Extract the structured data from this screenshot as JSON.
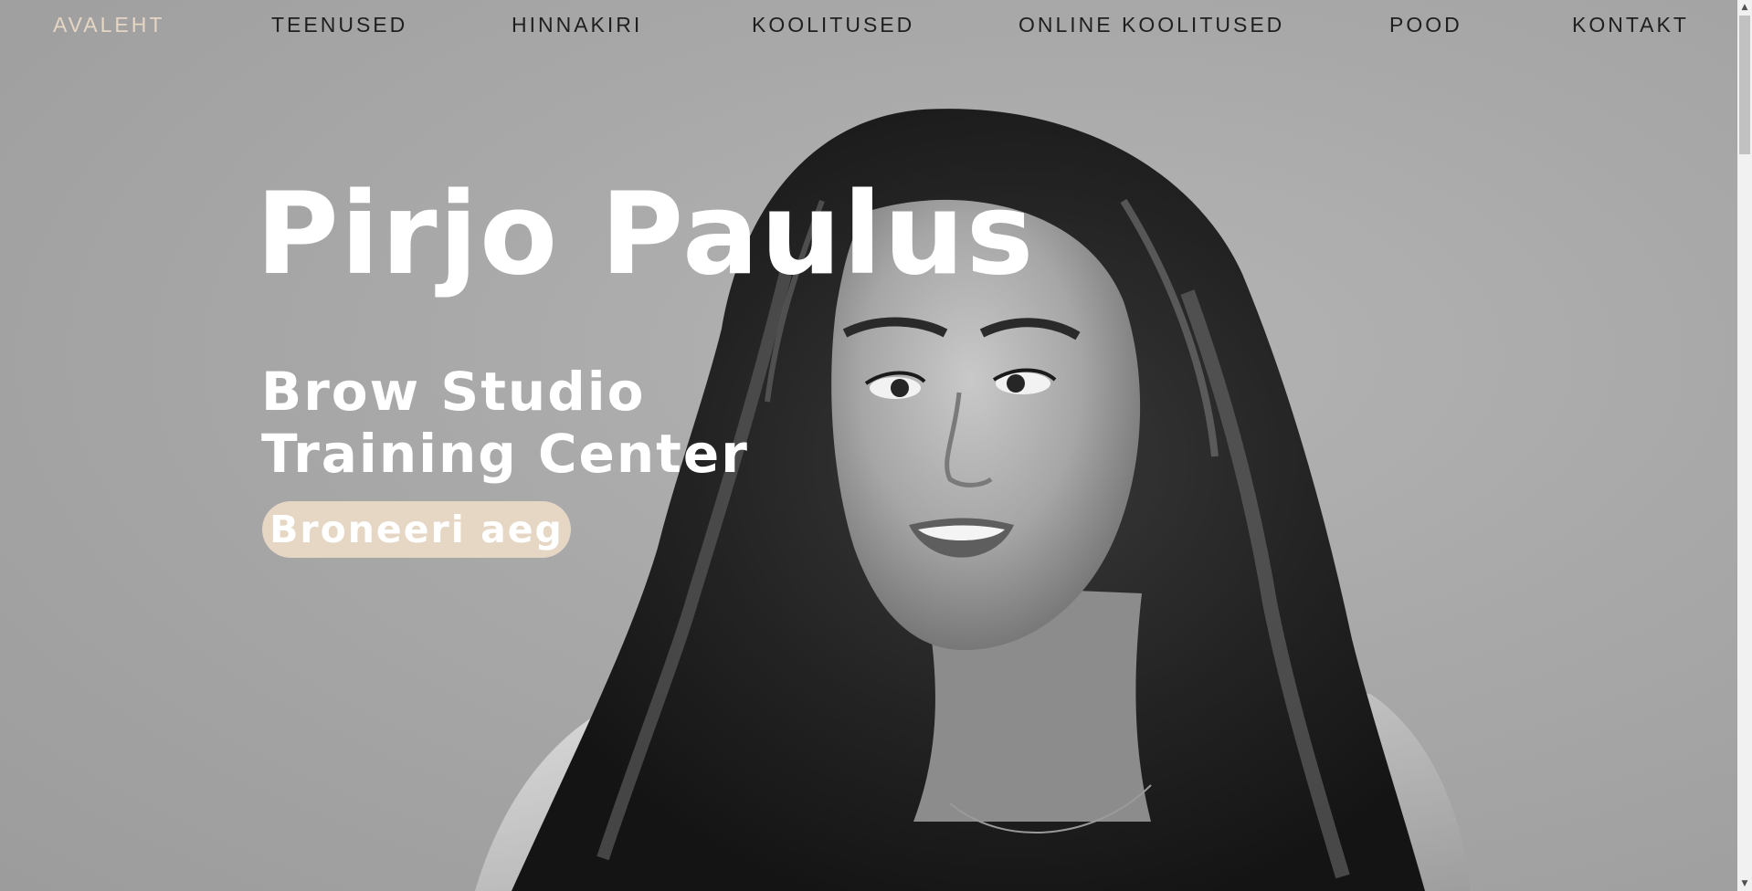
{
  "nav": {
    "items": [
      {
        "label": "AVALEHT",
        "active": true
      },
      {
        "label": "TEENUSED",
        "active": false
      },
      {
        "label": "HINNAKIRI",
        "active": false
      },
      {
        "label": "KOOLITUSED",
        "active": false
      },
      {
        "label": "ONLINE KOOLITUSED",
        "active": false
      },
      {
        "label": "POOD",
        "active": false
      },
      {
        "label": "KONTAKT",
        "active": false
      }
    ]
  },
  "hero": {
    "title": "Pirjo Paulus",
    "subtitle_line1": "Brow Studio",
    "subtitle_line2": "Training Center",
    "cta_label": "Broneeri aeg",
    "image_icon": "portrait-photo-grayscale"
  },
  "colors": {
    "accent": "#e6d6c4",
    "nav_text": "#1f1f1f",
    "hero_text": "#ffffff",
    "background": "#a9a9a9"
  }
}
